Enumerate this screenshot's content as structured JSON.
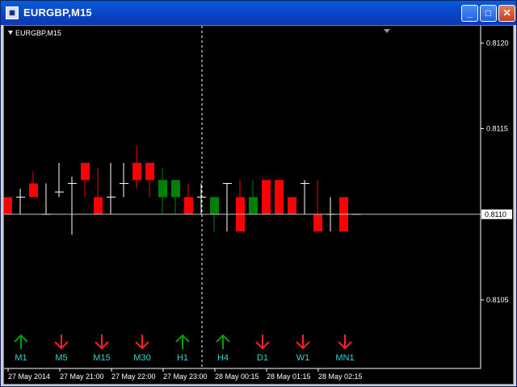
{
  "window": {
    "title": "EURGBP,M15"
  },
  "chart": {
    "label": "EURGBP,M15",
    "current_price": "0.8110",
    "price_levels": [
      "0.8120",
      "0.8115",
      "0.8110",
      "0.8105"
    ],
    "time_labels": [
      "27 May 2014",
      "27 May 21:00",
      "27 May 22:00",
      "27 May 23:00",
      "28 May 00:15",
      "28 May 01:15",
      "28 May 02:15"
    ]
  },
  "chart_data": {
    "type": "candlestick",
    "ylim": [
      0.8101,
      0.8121
    ],
    "candles": [
      {
        "o": 0.8111,
        "h": 0.8111,
        "l": 0.811,
        "c": 0.811
      },
      {
        "o": 0.8111,
        "h": 0.81115,
        "l": 0.811,
        "c": 0.8111
      },
      {
        "o": 0.81118,
        "h": 0.81125,
        "l": 0.8111,
        "c": 0.8111
      },
      {
        "o": 0.811,
        "h": 0.81118,
        "l": 0.811,
        "c": 0.811
      },
      {
        "o": 0.81113,
        "h": 0.8113,
        "l": 0.8111,
        "c": 0.81113
      },
      {
        "o": 0.81118,
        "h": 0.81122,
        "l": 0.81088,
        "c": 0.81118
      },
      {
        "o": 0.8113,
        "h": 0.8113,
        "l": 0.8111,
        "c": 0.8112
      },
      {
        "o": 0.8111,
        "h": 0.81127,
        "l": 0.811,
        "c": 0.811
      },
      {
        "o": 0.8111,
        "h": 0.8113,
        "l": 0.811,
        "c": 0.8111
      },
      {
        "o": 0.81118,
        "h": 0.8113,
        "l": 0.8111,
        "c": 0.81118
      },
      {
        "o": 0.8113,
        "h": 0.8114,
        "l": 0.81115,
        "c": 0.8112
      },
      {
        "o": 0.8113,
        "h": 0.8113,
        "l": 0.8111,
        "c": 0.8112
      },
      {
        "o": 0.8111,
        "h": 0.81127,
        "l": 0.811,
        "c": 0.8112
      },
      {
        "o": 0.8111,
        "h": 0.8112,
        "l": 0.811,
        "c": 0.8112
      },
      {
        "o": 0.8111,
        "h": 0.81118,
        "l": 0.811,
        "c": 0.811
      },
      {
        "o": 0.8111,
        "h": 0.81118,
        "l": 0.811,
        "c": 0.8111
      },
      {
        "o": 0.811,
        "h": 0.8111,
        "l": 0.8109,
        "c": 0.8111
      },
      {
        "o": 0.81118,
        "h": 0.81118,
        "l": 0.8109,
        "c": 0.81118
      },
      {
        "o": 0.8111,
        "h": 0.8112,
        "l": 0.8109,
        "c": 0.8109
      },
      {
        "o": 0.811,
        "h": 0.8112,
        "l": 0.811,
        "c": 0.8111
      },
      {
        "o": 0.8112,
        "h": 0.8112,
        "l": 0.811,
        "c": 0.811
      },
      {
        "o": 0.8112,
        "h": 0.8112,
        "l": 0.811,
        "c": 0.811
      },
      {
        "o": 0.8111,
        "h": 0.8111,
        "l": 0.811,
        "c": 0.811
      },
      {
        "o": 0.81118,
        "h": 0.8112,
        "l": 0.811,
        "c": 0.81118
      },
      {
        "o": 0.811,
        "h": 0.8112,
        "l": 0.8109,
        "c": 0.8109
      },
      {
        "o": 0.811,
        "h": 0.8111,
        "l": 0.8109,
        "c": 0.811
      },
      {
        "o": 0.8111,
        "h": 0.8111,
        "l": 0.8109,
        "c": 0.8109
      },
      {
        "o": 0.811,
        "h": 0.811,
        "l": 0.811,
        "c": 0.811
      }
    ]
  },
  "timeframes": [
    {
      "label": "M1",
      "direction": "up"
    },
    {
      "label": "M5",
      "direction": "down"
    },
    {
      "label": "M15",
      "direction": "down"
    },
    {
      "label": "M30",
      "direction": "down"
    },
    {
      "label": "H1",
      "direction": "up"
    },
    {
      "label": "H4",
      "direction": "up"
    },
    {
      "label": "D1",
      "direction": "down"
    },
    {
      "label": "W1",
      "direction": "down"
    },
    {
      "label": "MN1",
      "direction": "down"
    }
  ],
  "colors": {
    "background": "#000000",
    "bull": "#008000",
    "bear": "#ff0000",
    "doji": "#ffffff",
    "up_arrow": "#00a000",
    "down_arrow": "#ff2020",
    "timeframe_label": "#33d0d0",
    "axis": "#ffffff"
  }
}
